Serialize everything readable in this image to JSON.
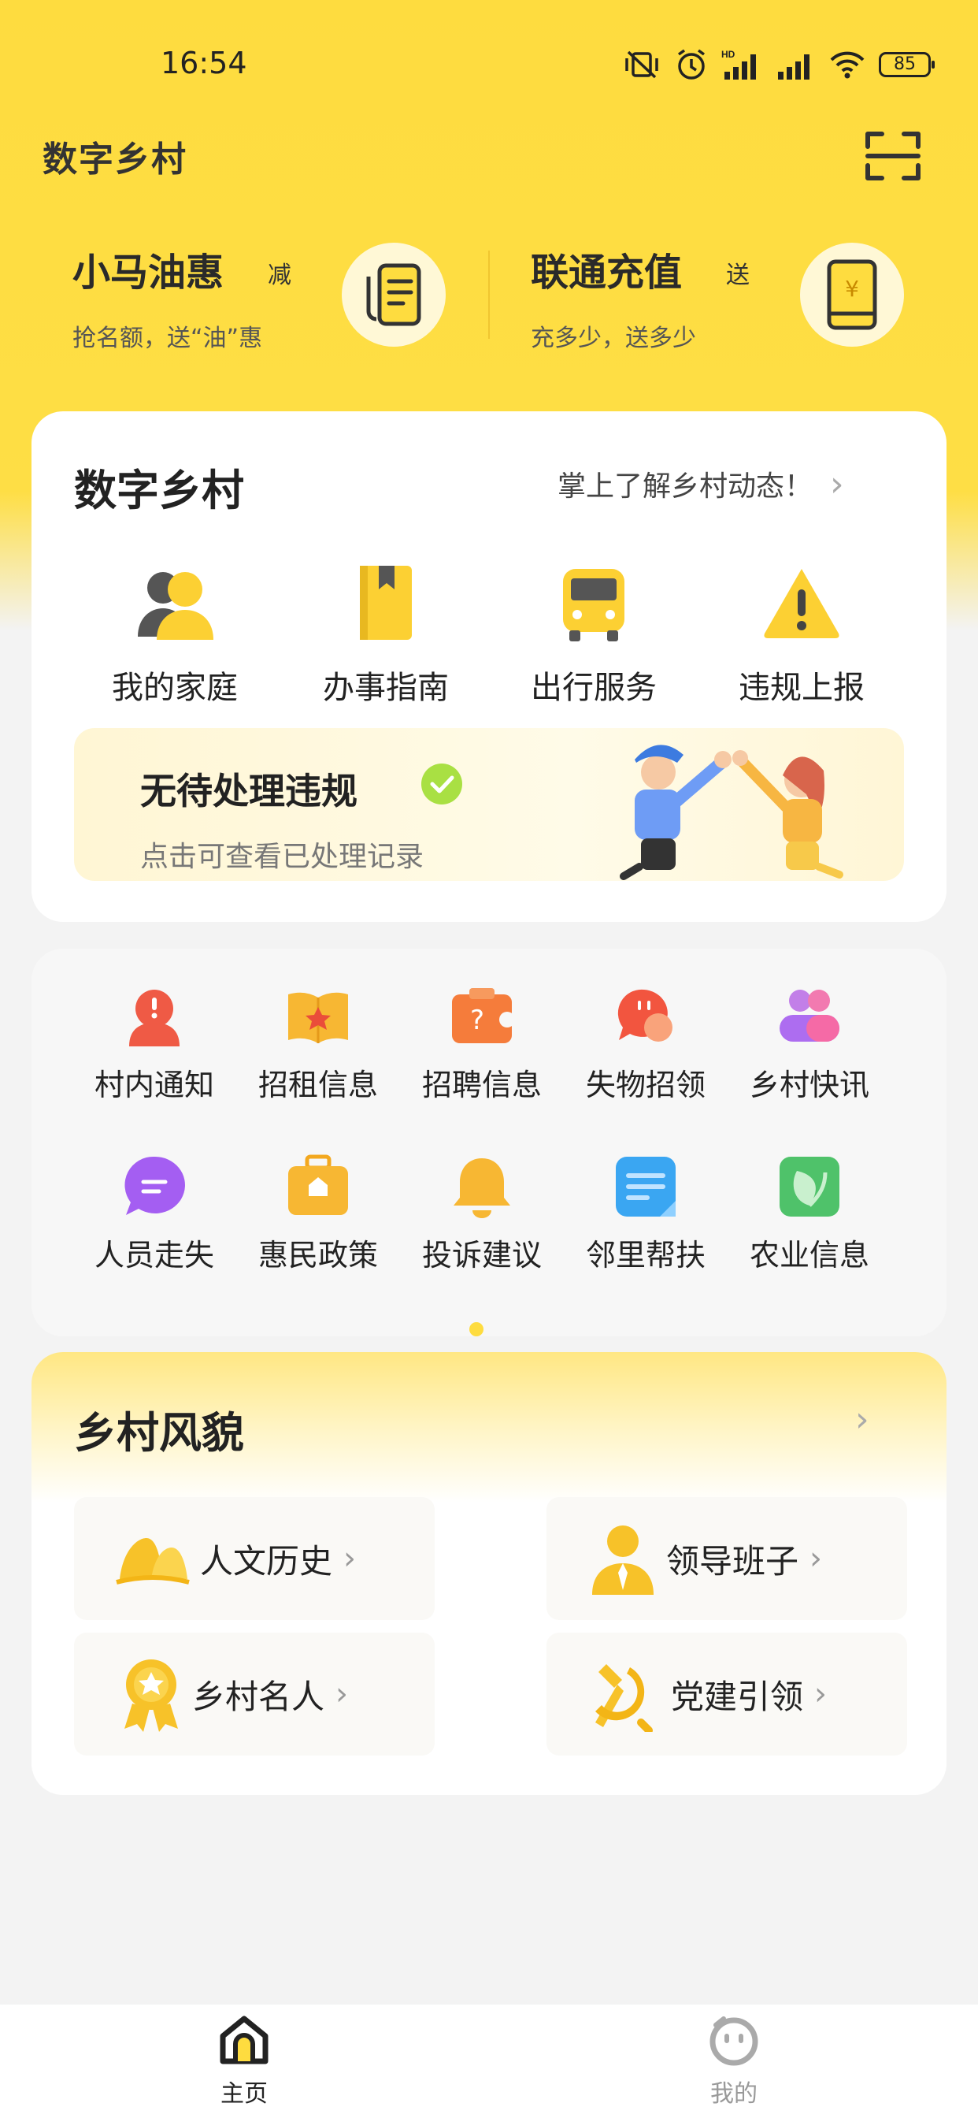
{
  "status_bar": {
    "time": "16:54",
    "battery": "85"
  },
  "header": {
    "app_title": "数字乡村"
  },
  "promos": [
    {
      "title": "小马油惠",
      "tag": "减",
      "subtitle": "抢名额，送“油”惠"
    },
    {
      "title": "联通充值",
      "tag": "送",
      "subtitle": "充多少，送多少"
    }
  ],
  "village_card": {
    "title": "数字乡村",
    "more": "掌上了解乡村动态！",
    "items": [
      {
        "label": "我的家庭",
        "icon": "family-icon"
      },
      {
        "label": "办事指南",
        "icon": "guide-book-icon"
      },
      {
        "label": "出行服务",
        "icon": "bus-icon"
      },
      {
        "label": "违规上报",
        "icon": "warning-icon"
      }
    ],
    "banner": {
      "title": "无待处理违规",
      "subtitle": "点击可查看已处理记录"
    }
  },
  "services": {
    "items": [
      {
        "label": "村内通知",
        "icon": "notice-icon"
      },
      {
        "label": "招租信息",
        "icon": "rental-icon"
      },
      {
        "label": "招聘信息",
        "icon": "recruit-icon"
      },
      {
        "label": "失物招领",
        "icon": "lost-found-icon"
      },
      {
        "label": "乡村快讯",
        "icon": "news-icon"
      },
      {
        "label": "人员走失",
        "icon": "missing-person-icon"
      },
      {
        "label": "惠民政策",
        "icon": "policy-icon"
      },
      {
        "label": "投诉建议",
        "icon": "bell-icon"
      },
      {
        "label": "邻里帮扶",
        "icon": "help-icon"
      },
      {
        "label": "农业信息",
        "icon": "agriculture-icon"
      }
    ]
  },
  "scenery_card": {
    "title": "乡村风貌",
    "tiles": [
      {
        "label": "人文历史",
        "icon": "mountain-icon"
      },
      {
        "label": "领导班子",
        "icon": "leader-icon"
      },
      {
        "label": "乡村名人",
        "icon": "medal-icon"
      },
      {
        "label": "党建引领",
        "icon": "party-emblem-icon"
      }
    ]
  },
  "bottom_nav": [
    {
      "label": "主页",
      "icon": "home-icon",
      "active": true
    },
    {
      "label": "我的",
      "icon": "profile-icon",
      "active": false
    }
  ],
  "colors": {
    "accent": "#fedc3f",
    "card": "#ffffff",
    "background": "#f3f3f3"
  }
}
